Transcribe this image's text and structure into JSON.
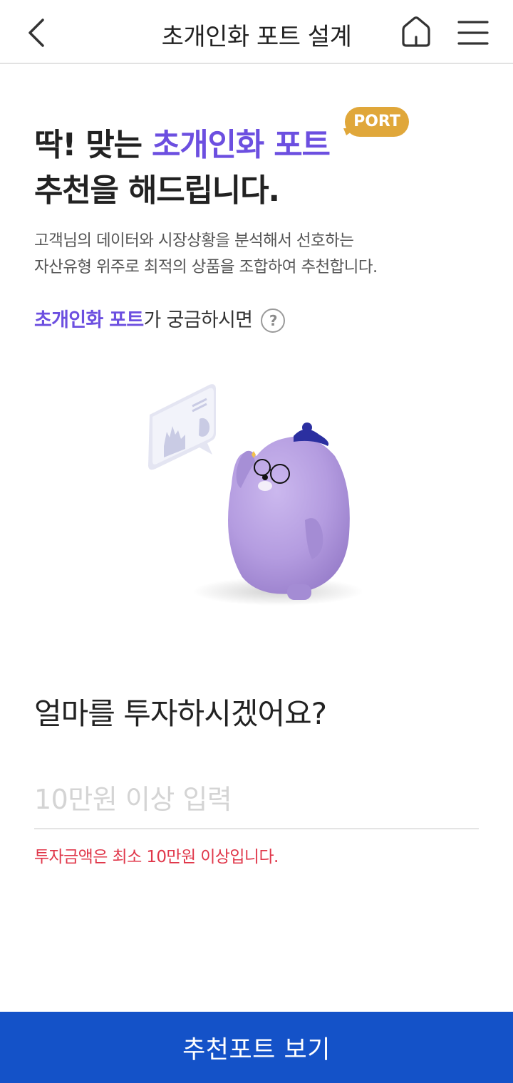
{
  "header": {
    "title": "초개인화 포트 설계",
    "back_icon": "chevron-left-icon",
    "home_icon": "home-icon",
    "menu_icon": "hamburger-menu-icon"
  },
  "hero": {
    "line1_prefix": "딱! 맞는 ",
    "line1_accent": "초개인화 포트",
    "line2": "추천을 해드립니다.",
    "badge": "PORT",
    "description_line1": "고객님의 데이터와 시장상황을 분석해서 선호하는",
    "description_line2": "자산유형 위주로 최적의 상품을 조합하여 추천합니다."
  },
  "info": {
    "accent": "초개인화 포트",
    "suffix": "가 궁금하시면",
    "help_symbol": "?"
  },
  "investment": {
    "question": "얼마를 투자하시겠어요?",
    "placeholder": "10만원 이상 입력",
    "value": "",
    "error": "투자금액은 최소 10만원 이상입니다."
  },
  "cta": {
    "label": "추천포트 보기"
  },
  "colors": {
    "accent": "#6c4fe0",
    "badge": "#e0a73a",
    "error": "#e0374a",
    "primary_button": "#1452c8"
  }
}
